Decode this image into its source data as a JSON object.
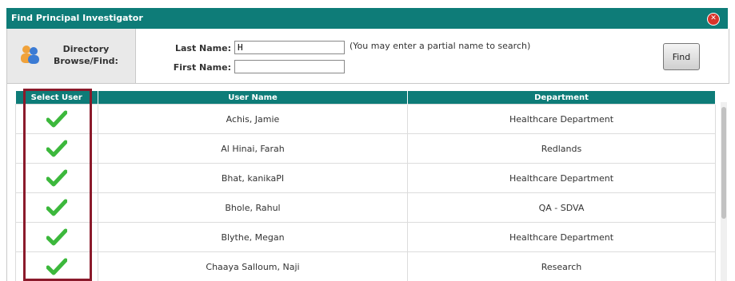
{
  "dialog": {
    "title": "Find Principal Investigator",
    "close_icon": "close-icon"
  },
  "search": {
    "directory_label_line1": "Directory",
    "directory_label_line2": "Browse/Find:",
    "last_name_label": "Last Name:",
    "last_name_value": "H",
    "first_name_label": "First Name:",
    "first_name_value": "",
    "hint": "(You may enter a partial name to search)",
    "find_button": "Find"
  },
  "table": {
    "headers": [
      "Select User",
      "User Name",
      "Department"
    ],
    "rows": [
      {
        "name": "Achis, Jamie",
        "department": "Healthcare Department"
      },
      {
        "name": "Al Hinai, Farah",
        "department": "Redlands"
      },
      {
        "name": "Bhat, kanikaPI",
        "department": "Healthcare Department"
      },
      {
        "name": "Bhole, Rahul",
        "department": "QA - SDVA"
      },
      {
        "name": "Blythe, Megan",
        "department": "Healthcare Department"
      },
      {
        "name": "Chaaya Salloum, Naji",
        "department": "Research"
      }
    ]
  },
  "colors": {
    "header": "#0e7c78",
    "check": "#3cb83c",
    "highlight": "#8b1a2b"
  }
}
